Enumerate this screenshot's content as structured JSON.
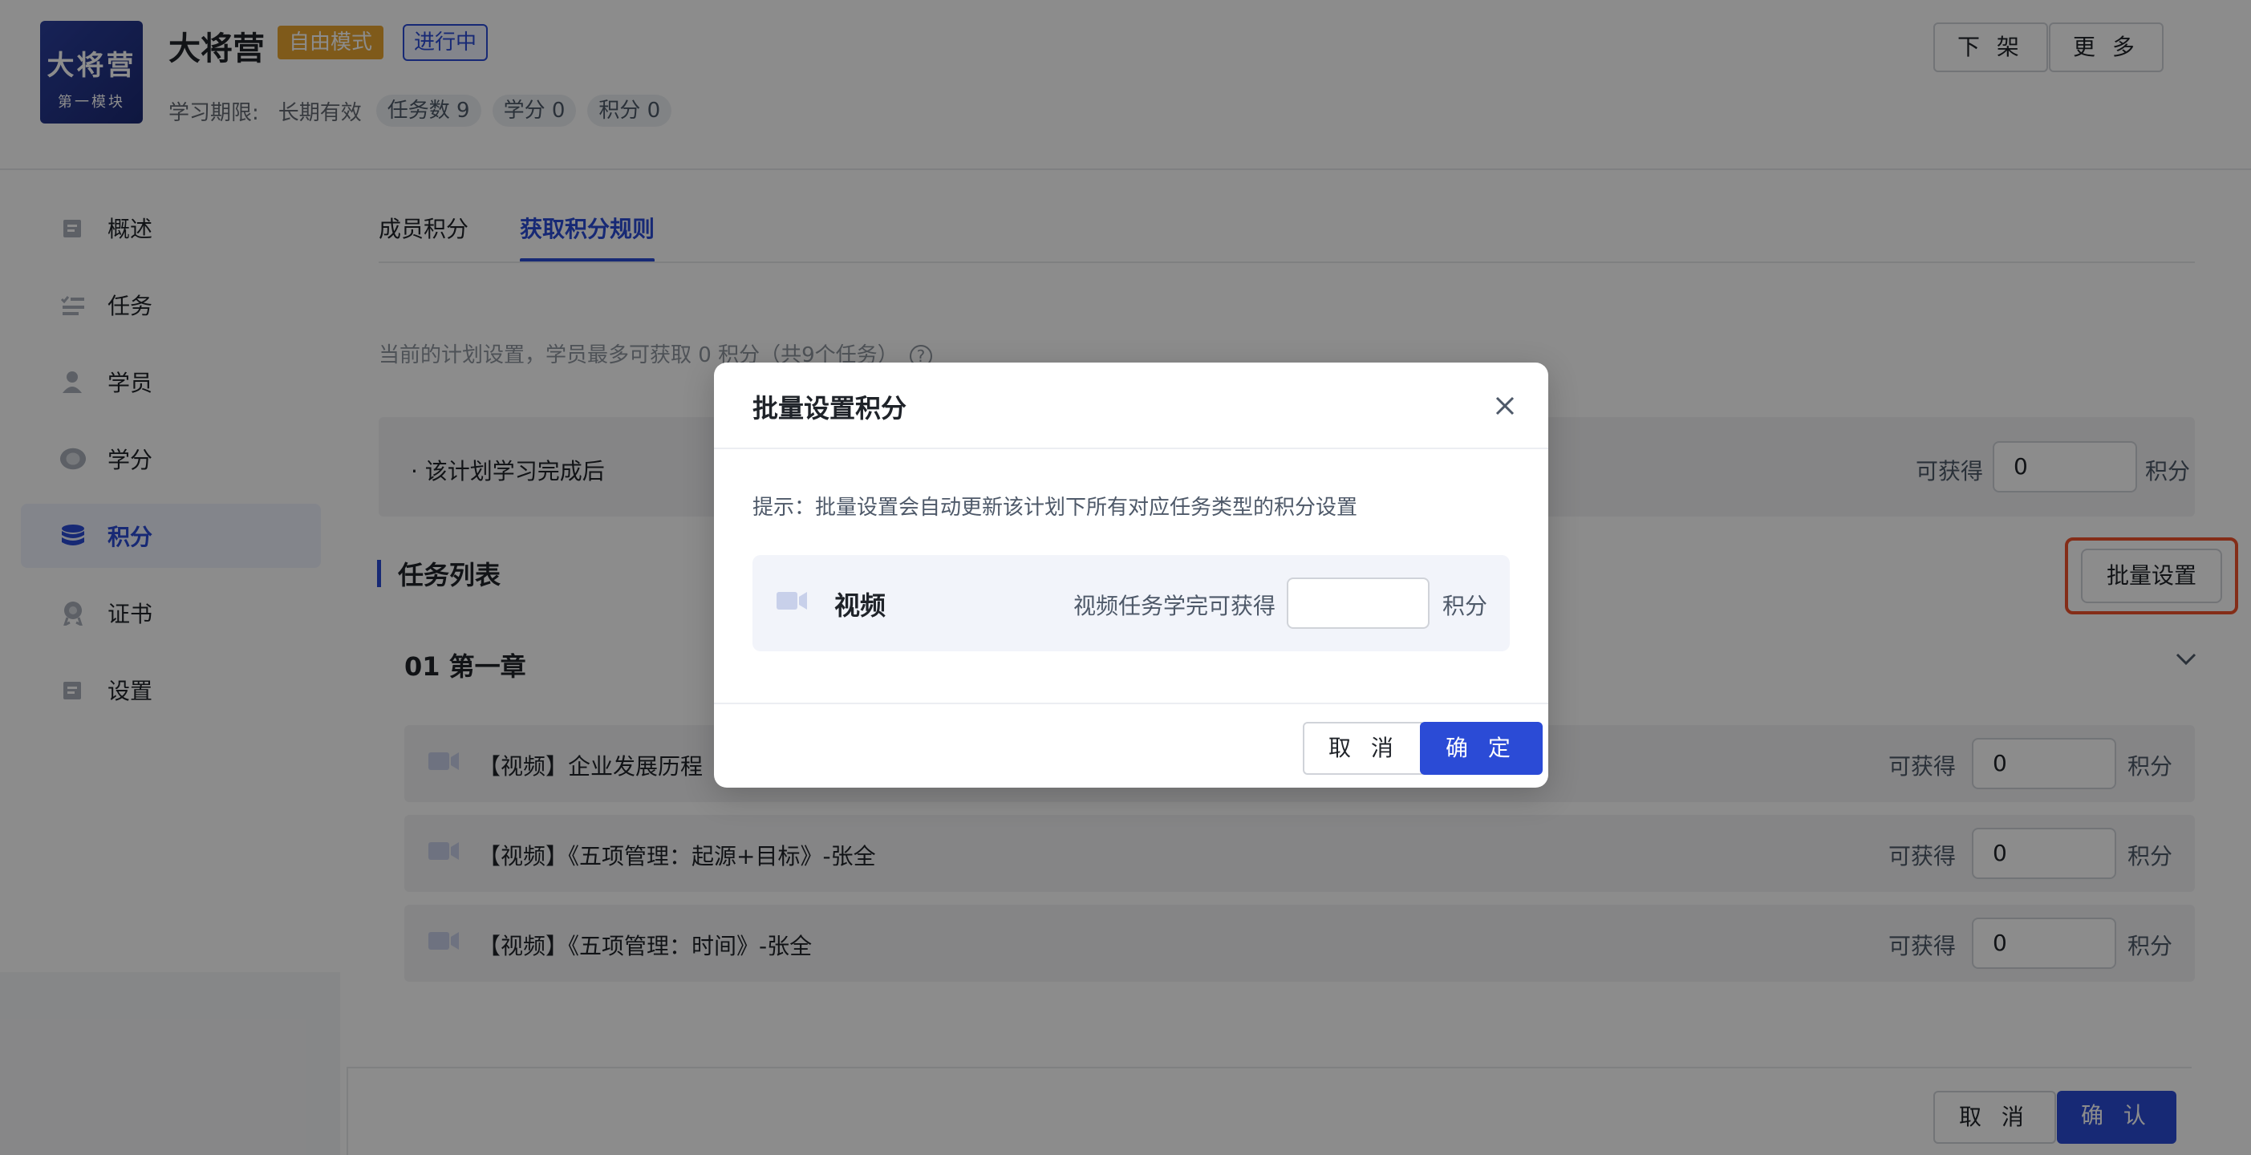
{
  "header": {
    "logo_line1": "大将营",
    "logo_line2": "第一模块",
    "title": "大将营",
    "mode_badge": "自由模式",
    "status_badge": "进行中",
    "period_label": "学习期限:",
    "period_value": "长期有效",
    "pills": [
      "任务数 9",
      "学分 0",
      "积分 0"
    ],
    "btn_unlist": "下 架",
    "btn_more": "更 多"
  },
  "sidebar": {
    "items": [
      {
        "label": "概述",
        "icon": "overview-icon"
      },
      {
        "label": "任务",
        "icon": "task-icon"
      },
      {
        "label": "学员",
        "icon": "student-icon"
      },
      {
        "label": "学分",
        "icon": "credit-icon"
      },
      {
        "label": "积分",
        "icon": "points-icon",
        "active": true
      },
      {
        "label": "证书",
        "icon": "certificate-icon"
      },
      {
        "label": "设置",
        "icon": "settings-icon"
      }
    ]
  },
  "tabs": [
    "成员积分",
    "获取积分规则"
  ],
  "active_tab": "获取积分规则",
  "plan_note": "当前的计划设置，学员最多可获取 0 积分（共9个任务）",
  "plan_completion": {
    "label": "· 该计划学习完成后",
    "obtain_label": "可获得",
    "value": "0",
    "unit": "积分"
  },
  "task_list": {
    "title": "任务列表",
    "batch_button": "批量设置",
    "chapter": "01  第一章",
    "obtain_label": "可获得",
    "unit": "积分",
    "tasks": [
      {
        "name": "【视频】企业发展历程",
        "value": "0"
      },
      {
        "name": "【视频】《五项管理：起源+目标》-张全",
        "value": "0"
      },
      {
        "name": "【视频】《五项管理：时间》-张全",
        "value": "0"
      }
    ]
  },
  "footer": {
    "cancel": "取 消",
    "confirm": "确 认"
  },
  "modal": {
    "title": "批量设置积分",
    "hint": "提示：批量设置会自动更新该计划下所有对应任务类型的积分设置",
    "card_name": "视频",
    "card_label": "视频任务学完可获得",
    "card_value": "",
    "card_unit": "积分",
    "cancel": "取 消",
    "confirm": "确 定"
  },
  "colors": {
    "primary": "#2b4bd6",
    "mode_badge": "#e8a530",
    "highlight": "#f0532d"
  }
}
